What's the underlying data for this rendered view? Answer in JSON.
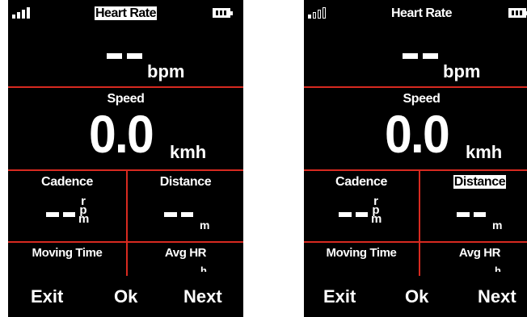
{
  "screens": [
    {
      "title": "Heart Rate",
      "title_highlighted": true,
      "signal": "full",
      "heart_rate": {
        "value": "--",
        "unit": "bpm"
      },
      "speed": {
        "label": "Speed",
        "value": "0.0",
        "unit": "kmh"
      },
      "cadence": {
        "label": "Cadence",
        "value": "--",
        "unit": [
          "r",
          "p",
          "m"
        ]
      },
      "distance": {
        "label": "Distance",
        "value": "--",
        "unit": "m",
        "highlighted": false
      },
      "moving_time": {
        "label": "Moving Time"
      },
      "avg_hr": {
        "label": "Avg HR",
        "unit_partial": "h"
      },
      "softkeys": {
        "exit": "Exit",
        "ok": "Ok",
        "next": "Next"
      }
    },
    {
      "title": "Heart Rate",
      "title_highlighted": false,
      "signal": "weak",
      "heart_rate": {
        "value": "--",
        "unit": "bpm"
      },
      "speed": {
        "label": "Speed",
        "value": "0.0",
        "unit": "kmh"
      },
      "cadence": {
        "label": "Cadence",
        "value": "--",
        "unit": [
          "r",
          "p",
          "m"
        ]
      },
      "distance": {
        "label": "Distance",
        "value": "--",
        "unit": "m",
        "highlighted": true
      },
      "moving_time": {
        "label": "Moving Time"
      },
      "avg_hr": {
        "label": "Avg HR",
        "unit_partial": "h"
      },
      "softkeys": {
        "exit": "Exit",
        "ok": "Ok",
        "next": "Next"
      }
    }
  ],
  "colors": {
    "background": "#000000",
    "divider": "#d72a20",
    "text": "#ffffff"
  },
  "icons": [
    "signal-strength-icon",
    "battery-icon"
  ]
}
